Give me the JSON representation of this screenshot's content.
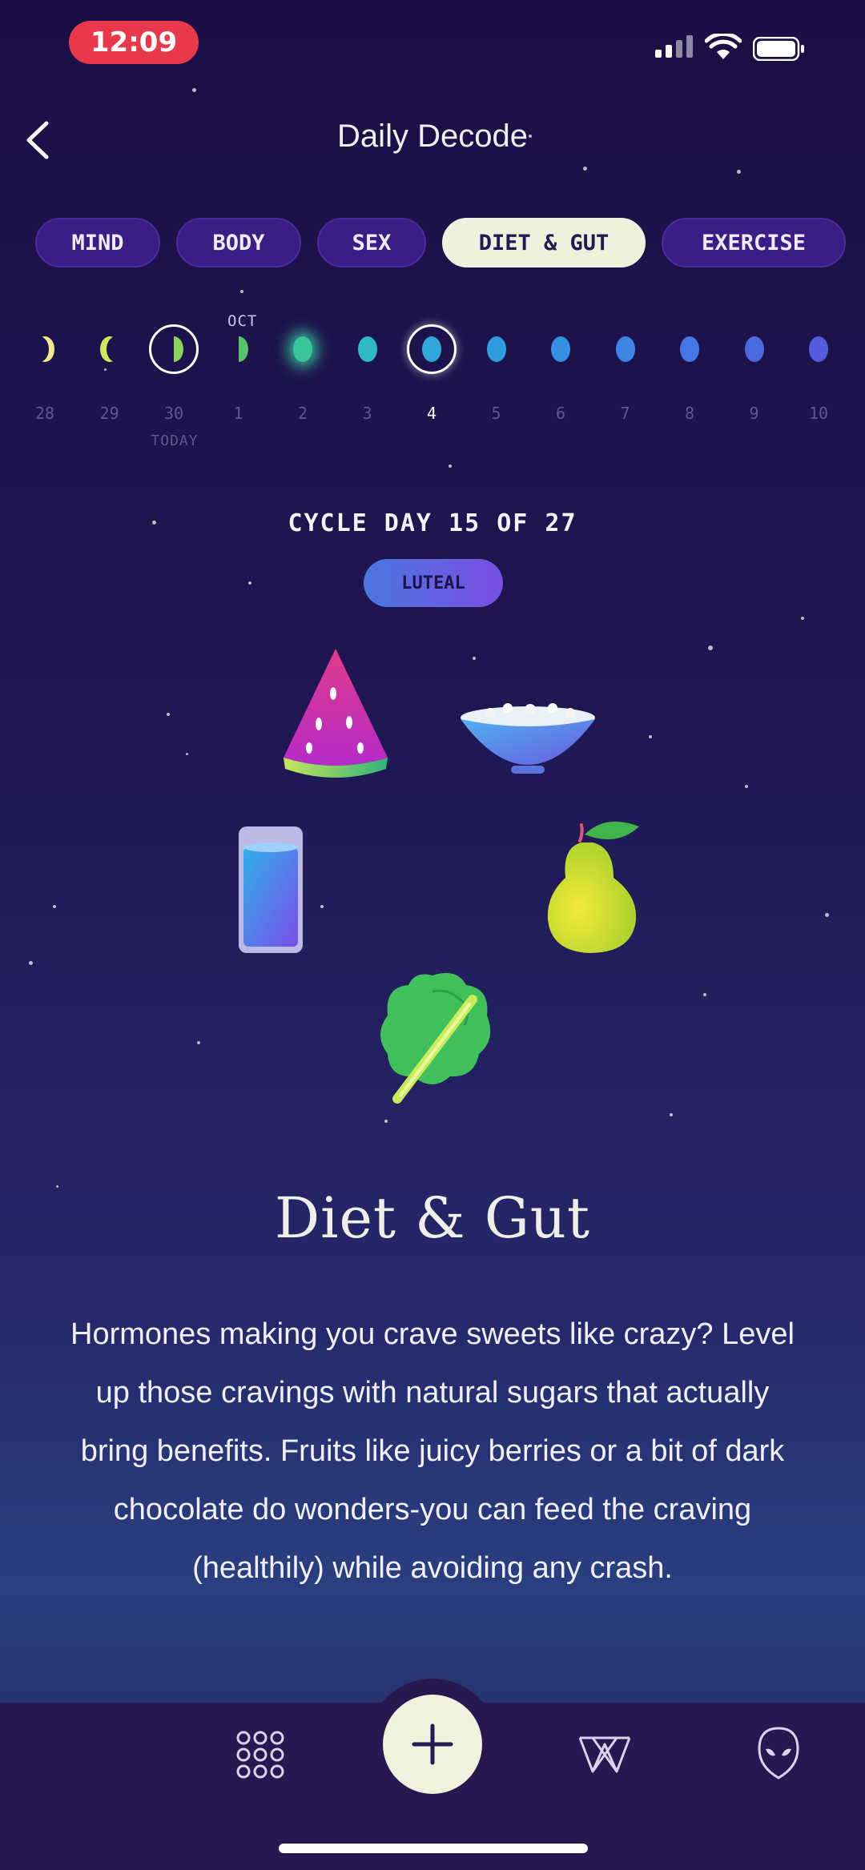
{
  "status_bar": {
    "time": "12:09"
  },
  "header": {
    "title": "Daily Decode"
  },
  "tabs": [
    {
      "label": "MIND",
      "active": false
    },
    {
      "label": "BODY",
      "active": false
    },
    {
      "label": "SEX",
      "active": false
    },
    {
      "label": "DIET & GUT",
      "active": true
    },
    {
      "label": "EXERCISE",
      "active": false
    }
  ],
  "calendar": {
    "month_label": "OCT",
    "today_label": "TODAY",
    "days": [
      {
        "num": "28",
        "phase": "waning crescent",
        "color": "#f3e98c"
      },
      {
        "num": "29",
        "phase": "first crescent",
        "color": "#cfe55a"
      },
      {
        "num": "30",
        "phase": "first quarter",
        "color": "#8ad45b",
        "today": true
      },
      {
        "num": "1",
        "phase": "half",
        "color": "#55c56a"
      },
      {
        "num": "2",
        "phase": "full glow",
        "color": "#38c59a"
      },
      {
        "num": "3",
        "phase": "full",
        "color": "#2dbac0"
      },
      {
        "num": "4",
        "phase": "full",
        "color": "#2fa7d8",
        "current": true
      },
      {
        "num": "5",
        "phase": "full",
        "color": "#2f9cdf"
      },
      {
        "num": "6",
        "phase": "full",
        "color": "#3690e2"
      },
      {
        "num": "7",
        "phase": "full",
        "color": "#3d84e5"
      },
      {
        "num": "8",
        "phase": "full",
        "color": "#4477e5"
      },
      {
        "num": "9",
        "phase": "full",
        "color": "#4b6ae2"
      },
      {
        "num": "10",
        "phase": "full",
        "color": "#525edd"
      }
    ]
  },
  "cycle": {
    "label": "CYCLE DAY 15 OF 27",
    "phase": "LUTEAL"
  },
  "illustrations": [
    "watermelon-slice",
    "cereal-bowl",
    "glass-of-water",
    "pear",
    "leafy-green"
  ],
  "section": {
    "title": "Diet & Gut",
    "body": "Hormones making you crave sweets like crazy? Level up those cravings with natural sugars that actually bring benefits. Fruits like juicy berries or a bit of dark chocolate do wonders-you can feed the craving (healthily) while avoiding any crash."
  },
  "bottom_nav": {
    "items": [
      "moon-icon",
      "grid-icon",
      "add-icon",
      "w-logo-icon",
      "alien-icon"
    ]
  },
  "colors": {
    "accent": "#eef2dc",
    "tab_bg": "#3a1e85",
    "badge_start": "#4a76e0",
    "badge_end": "#7a4ee0"
  }
}
